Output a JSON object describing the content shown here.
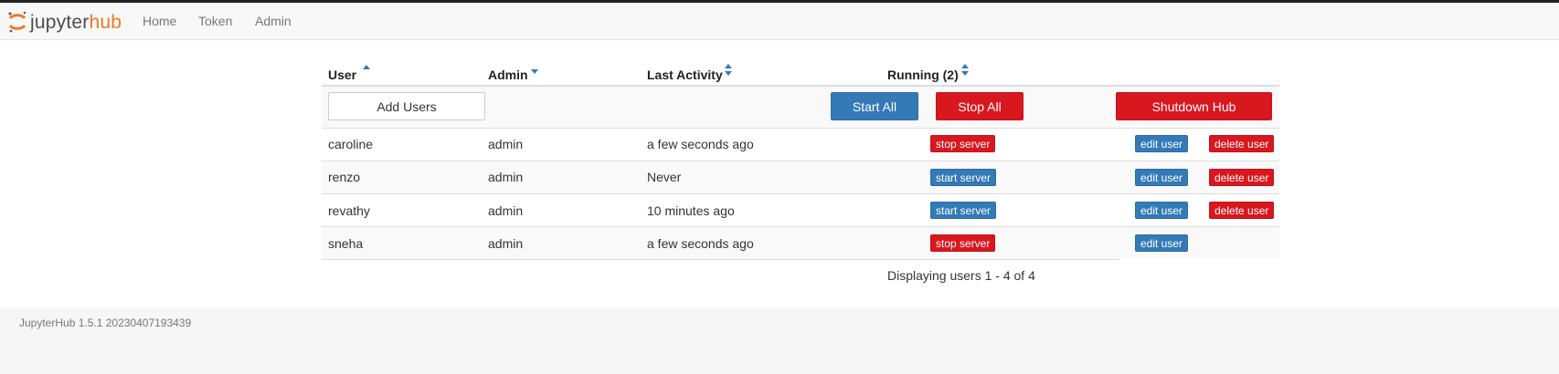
{
  "app": {
    "logo_text_part1": "jupyter",
    "logo_text_part2": "hub",
    "logo_icon": "jupyter-logo-icon",
    "accent_color": "#f37726"
  },
  "nav": {
    "items": [
      {
        "label": "Home"
      },
      {
        "label": "Token"
      },
      {
        "label": "Admin"
      }
    ]
  },
  "table": {
    "columns": [
      {
        "label": "User",
        "sort": "asc-active"
      },
      {
        "label": "Admin",
        "sort": "desc-active"
      },
      {
        "label": "Last Activity",
        "sort": "both"
      },
      {
        "label": "Running (2)",
        "sort": "both"
      }
    ],
    "toolbar": {
      "add_users": "Add Users",
      "start_all": "Start All",
      "stop_all": "Stop All",
      "shutdown_hub": "Shutdown Hub"
    },
    "rows": [
      {
        "name": "caroline",
        "admin": "admin",
        "last_activity": "a few seconds ago",
        "server_action": "stop server",
        "edit": "edit user",
        "delete": "delete user"
      },
      {
        "name": "renzo",
        "admin": "admin",
        "last_activity": "Never",
        "server_action": "start server",
        "edit": "edit user",
        "delete": "delete user"
      },
      {
        "name": "revathy",
        "admin": "admin",
        "last_activity": "10 minutes ago",
        "server_action": "start server",
        "edit": "edit user",
        "delete": "delete user"
      },
      {
        "name": "sneha",
        "admin": "admin",
        "last_activity": "a few seconds ago",
        "server_action": "stop server",
        "edit": "edit user",
        "delete": ""
      }
    ],
    "pagination": "Displaying users 1 - 4 of 4"
  },
  "footer": {
    "version": "JupyterHub 1.5.1 20230407193439"
  },
  "colors": {
    "primary": "#337ab7",
    "danger": "#d9171f"
  }
}
